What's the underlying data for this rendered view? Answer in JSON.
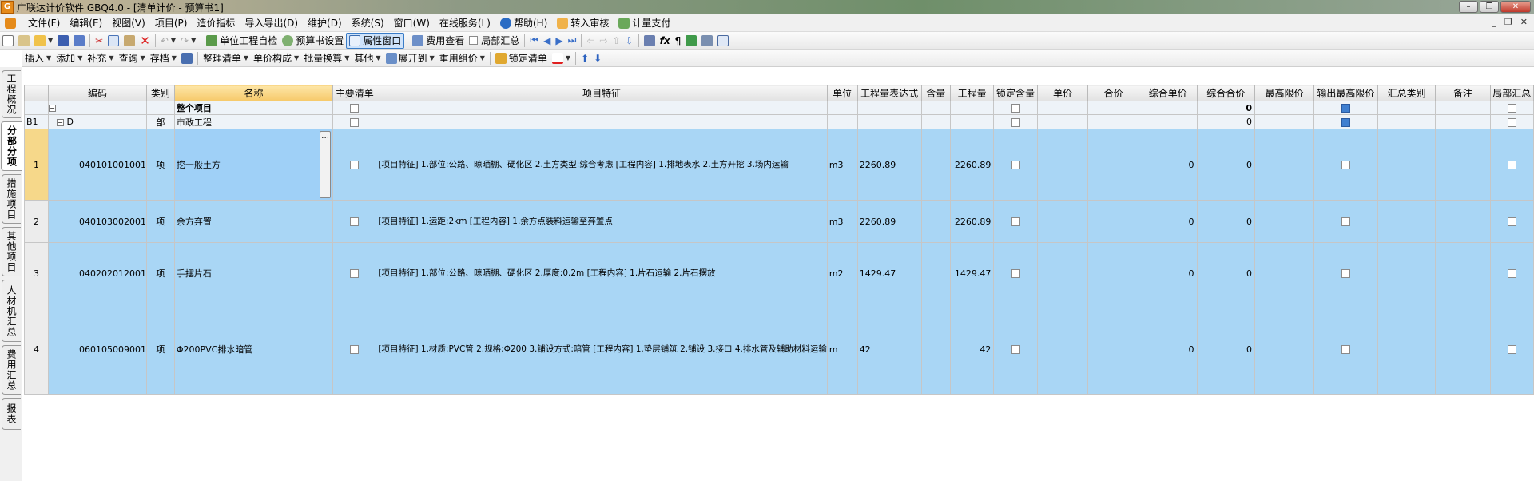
{
  "window": {
    "title": "广联达计价软件 GBQ4.0 - [清单计价 - 预算书1]",
    "app_icon": "G"
  },
  "menu": [
    {
      "label": "文件(F)"
    },
    {
      "label": "编辑(E)"
    },
    {
      "label": "视图(V)"
    },
    {
      "label": "项目(P)"
    },
    {
      "label": "造价指标"
    },
    {
      "label": "导入导出(D)"
    },
    {
      "label": "维护(D)"
    },
    {
      "label": "系统(S)"
    },
    {
      "label": "窗口(W)"
    },
    {
      "label": "在线服务(L)"
    },
    {
      "label": "帮助(H)",
      "icon": "help-icon"
    },
    {
      "label": "转入审核",
      "icon": "audit-icon"
    },
    {
      "label": "计量支付",
      "icon": "payment-icon"
    }
  ],
  "toolbar1": {
    "self_check": "单位工程自检",
    "budget_settings": "预算书设置",
    "property_window": "属性窗口",
    "cost_view": "费用查看",
    "partial_summary": "局部汇总"
  },
  "toolbar2": {
    "insert": "插入",
    "add": "添加",
    "supplement": "补充",
    "query": "查询",
    "archive": "存档",
    "organize": "整理清单",
    "unit_price_comp": "单价构成",
    "batch_convert": "批量换算",
    "other": "其他",
    "expand_to": "展开到",
    "reuse_pricing": "重用组价",
    "lock_list": "锁定清单"
  },
  "side_tabs": [
    "工程概况",
    "分部分项",
    "措施项目",
    "其他项目",
    "人材机汇总",
    "费用汇总",
    "报表"
  ],
  "columns": [
    "",
    "编码",
    "类别",
    "名称",
    "主要清单",
    "项目特征",
    "单位",
    "工程量表达式",
    "含量",
    "工程量",
    "锁定含量",
    "单价",
    "合价",
    "综合单价",
    "综合合价",
    "最高限价",
    "输出最高限价",
    "汇总类别",
    "备注",
    "局部汇总"
  ],
  "rows": {
    "total": {
      "name": "整个项目",
      "total_price": "0"
    },
    "division": {
      "rownum": "B1",
      "code": "D",
      "category": "部",
      "name": "市政工程",
      "total_price": "0"
    },
    "items": [
      {
        "rownum": "1",
        "code": "040101001001",
        "category": "项",
        "name": "挖一般土方",
        "feature": "[项目特征]\n1.部位:公路、晾晒棚、硬化区\n2.土方类型:综合考虑\n[工程内容]\n1.排地表水\n2.土方开挖\n3.场内运输",
        "unit": "m3",
        "qty_expr": "2260.89",
        "qty": "2260.89",
        "unit_rate": "0",
        "total_price": "0"
      },
      {
        "rownum": "2",
        "code": "040103002001",
        "category": "项",
        "name": "余方弃置",
        "feature": "[项目特征]\n1.运距:2km\n[工程内容]\n1.余方点装料运输至弃置点",
        "unit": "m3",
        "qty_expr": "2260.89",
        "qty": "2260.89",
        "unit_rate": "0",
        "total_price": "0"
      },
      {
        "rownum": "3",
        "code": "040202012001",
        "category": "项",
        "name": "手摆片石",
        "feature": "[项目特征]\n1.部位:公路、晾晒棚、硬化区\n2.厚度:0.2m\n[工程内容]\n1.片石运输\n2.片石摆放",
        "unit": "m2",
        "qty_expr": "1429.47",
        "qty": "1429.47",
        "unit_rate": "0",
        "total_price": "0"
      },
      {
        "rownum": "4",
        "code": "060105009001",
        "category": "项",
        "name": "Φ200PVC排水暗管",
        "feature": "[项目特征]\n1.材质:PVC管\n2.规格:Φ200\n3.铺设方式:暗管\n[工程内容]\n1.垫层铺筑\n2.铺设\n3.接口\n4.排水管及辅助材料运输",
        "unit": "m",
        "qty_expr": "42",
        "qty": "42",
        "unit_rate": "0",
        "total_price": "0"
      }
    ]
  },
  "colors": {
    "selected_row": "#a9d6f5",
    "header_highlight": "#f6c96a",
    "current_row_marker": "#f6d88a"
  }
}
